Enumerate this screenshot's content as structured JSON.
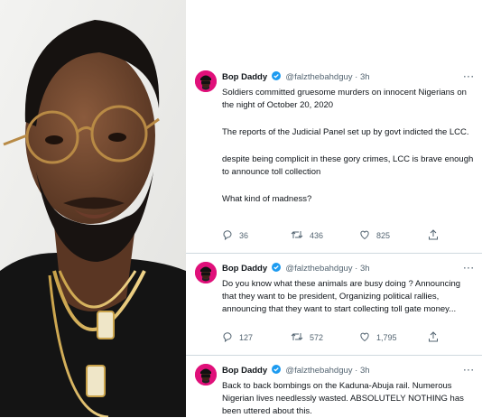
{
  "tweets": [
    {
      "display_name": "Bop Daddy",
      "handle": "@falzthebahdguy",
      "time": "3h",
      "paragraphs": [
        "Soldiers committed gruesome murders on innocent Nigerians on the night of October 20, 2020",
        "The reports of the Judicial Panel set up by govt indicted the LCC.",
        "despite being complicit in these gory crimes, LCC is brave enough to announce toll collection",
        "What kind of madness?"
      ],
      "replies": "36",
      "retweets": "436",
      "likes": "825"
    },
    {
      "display_name": "Bop Daddy",
      "handle": "@falzthebahdguy",
      "time": "3h",
      "paragraphs": [
        "Do you know what these animals are busy doing ? Announcing that they want to be president, Organizing political rallies, announcing that they want to start collecting toll gate money..."
      ],
      "replies": "127",
      "retweets": "572",
      "likes": "1,795"
    },
    {
      "display_name": "Bop Daddy",
      "handle": "@falzthebahdguy",
      "time": "3h",
      "paragraphs": [
        "Back to back bombings on the Kaduna-Abuja rail. Numerous Nigerian lives needlessly wasted. ABSOLUTELY NOTHING has been uttered about this."
      ]
    }
  ],
  "icons": {
    "verified": "verified-badge-icon",
    "reply": "reply-icon",
    "retweet": "retweet-icon",
    "like": "like-icon",
    "share": "share-icon",
    "more": "more-icon"
  },
  "colors": {
    "verified": "#1d9bf0",
    "avatar": "#e0107a",
    "text": "#0f1419",
    "muted": "#536471",
    "divider": "#cfd9de"
  }
}
